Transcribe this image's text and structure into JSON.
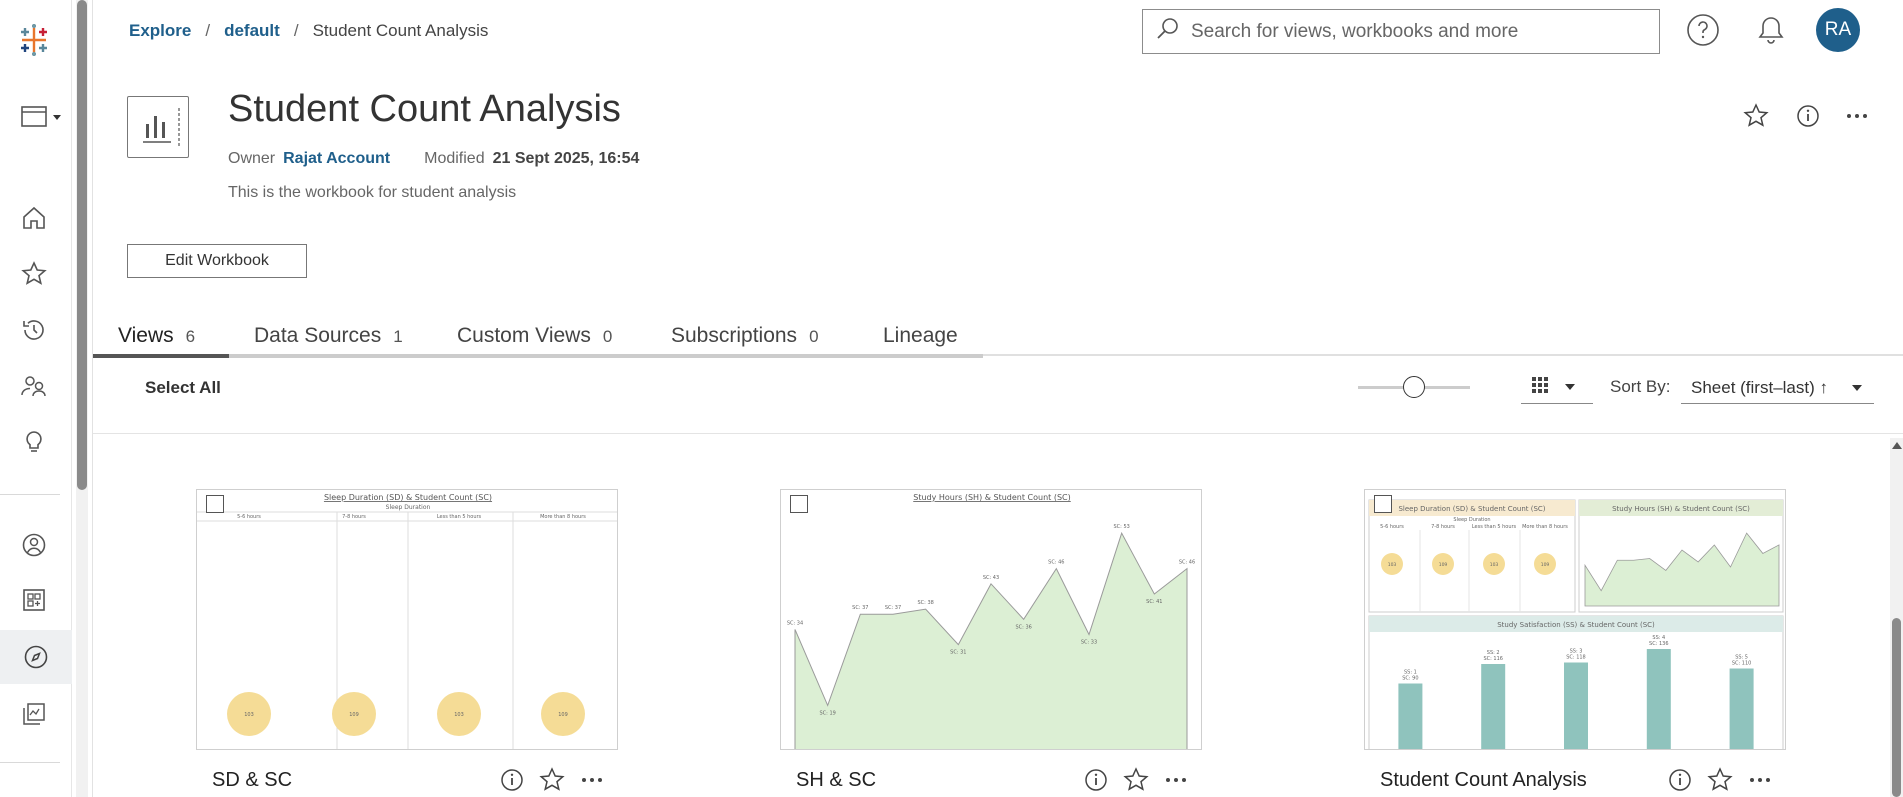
{
  "breadcrumb": {
    "explore": "Explore",
    "sep": "/",
    "project": "default",
    "current": "Student Count Analysis"
  },
  "search": {
    "placeholder": "Search for views, workbooks and more"
  },
  "user": {
    "initials": "RA"
  },
  "colors": {
    "accent": "#1f5f8b",
    "yellow": "#f5dc96",
    "green": "#dcefd4",
    "teal": "#8fc3bd"
  },
  "workbook": {
    "title": "Student Count Analysis",
    "owner_label": "Owner",
    "owner": "Rajat Account",
    "modified_label": "Modified",
    "modified": "21 Sept 2025, 16:54",
    "description": "This is the workbook for student analysis",
    "edit_label": "Edit Workbook"
  },
  "tabs": [
    {
      "label": "Views",
      "count": "6"
    },
    {
      "label": "Data Sources",
      "count": "1"
    },
    {
      "label": "Custom Views",
      "count": "0"
    },
    {
      "label": "Subscriptions",
      "count": "0"
    },
    {
      "label": "Lineage",
      "count": ""
    }
  ],
  "toolbar": {
    "select_all": "Select All",
    "thumb_size_fraction": 0.5,
    "sort_label": "Sort By:",
    "sort_value": "Sheet (first–last) ↑"
  },
  "views": [
    {
      "name": "SD & SC",
      "thumb_title": "Sleep Duration (SD) & Student Count (SC)",
      "subheader": "Sleep Duration",
      "categories": [
        "5-6 hours",
        "7-8 hours",
        "Less than 5 hours",
        "More than 8 hours"
      ],
      "values": [
        "103",
        "109",
        "103",
        "109"
      ]
    },
    {
      "name": "SH & SC",
      "thumb_title": "Study Hours (SH) & Student Count (SC)",
      "points": [
        34,
        19,
        37,
        37,
        38,
        31,
        43,
        36,
        46,
        33,
        53,
        41,
        46
      ],
      "labels": [
        "SC: 34",
        "SC: 19",
        "SC: 37",
        "SC: 37",
        "SC: 38",
        "SC: 31",
        "SC: 43",
        "SC: 36",
        "SC: 46",
        "SC: 33",
        "SC: 53",
        "SC: 41",
        "SC: 46"
      ]
    },
    {
      "name": "Student Count Analysis",
      "panel1_title": "Sleep Duration (SD) & Student Count (SC)",
      "panel2_title": "Study Hours (SH) & Student Count (SC)",
      "panel3_title": "Study Satisfaction (SS) & Student Count (SC)",
      "sd_sub": "Sleep Duration",
      "sd_categories": [
        "5-6 hours",
        "7-8 hours",
        "Less than 5 hours",
        "More than 8 hours"
      ],
      "sd_values": [
        "103",
        "109",
        "103",
        "109"
      ],
      "bars": [
        90,
        116,
        118,
        136,
        110
      ],
      "bar_labels": [
        "SS: 1",
        "SS: 2",
        "SS: 3",
        "SS: 4",
        "SS: 5"
      ],
      "bar_values": [
        "SC: 90",
        "SC: 116",
        "SC: 118",
        "SC: 136",
        "SC: 110"
      ]
    }
  ]
}
